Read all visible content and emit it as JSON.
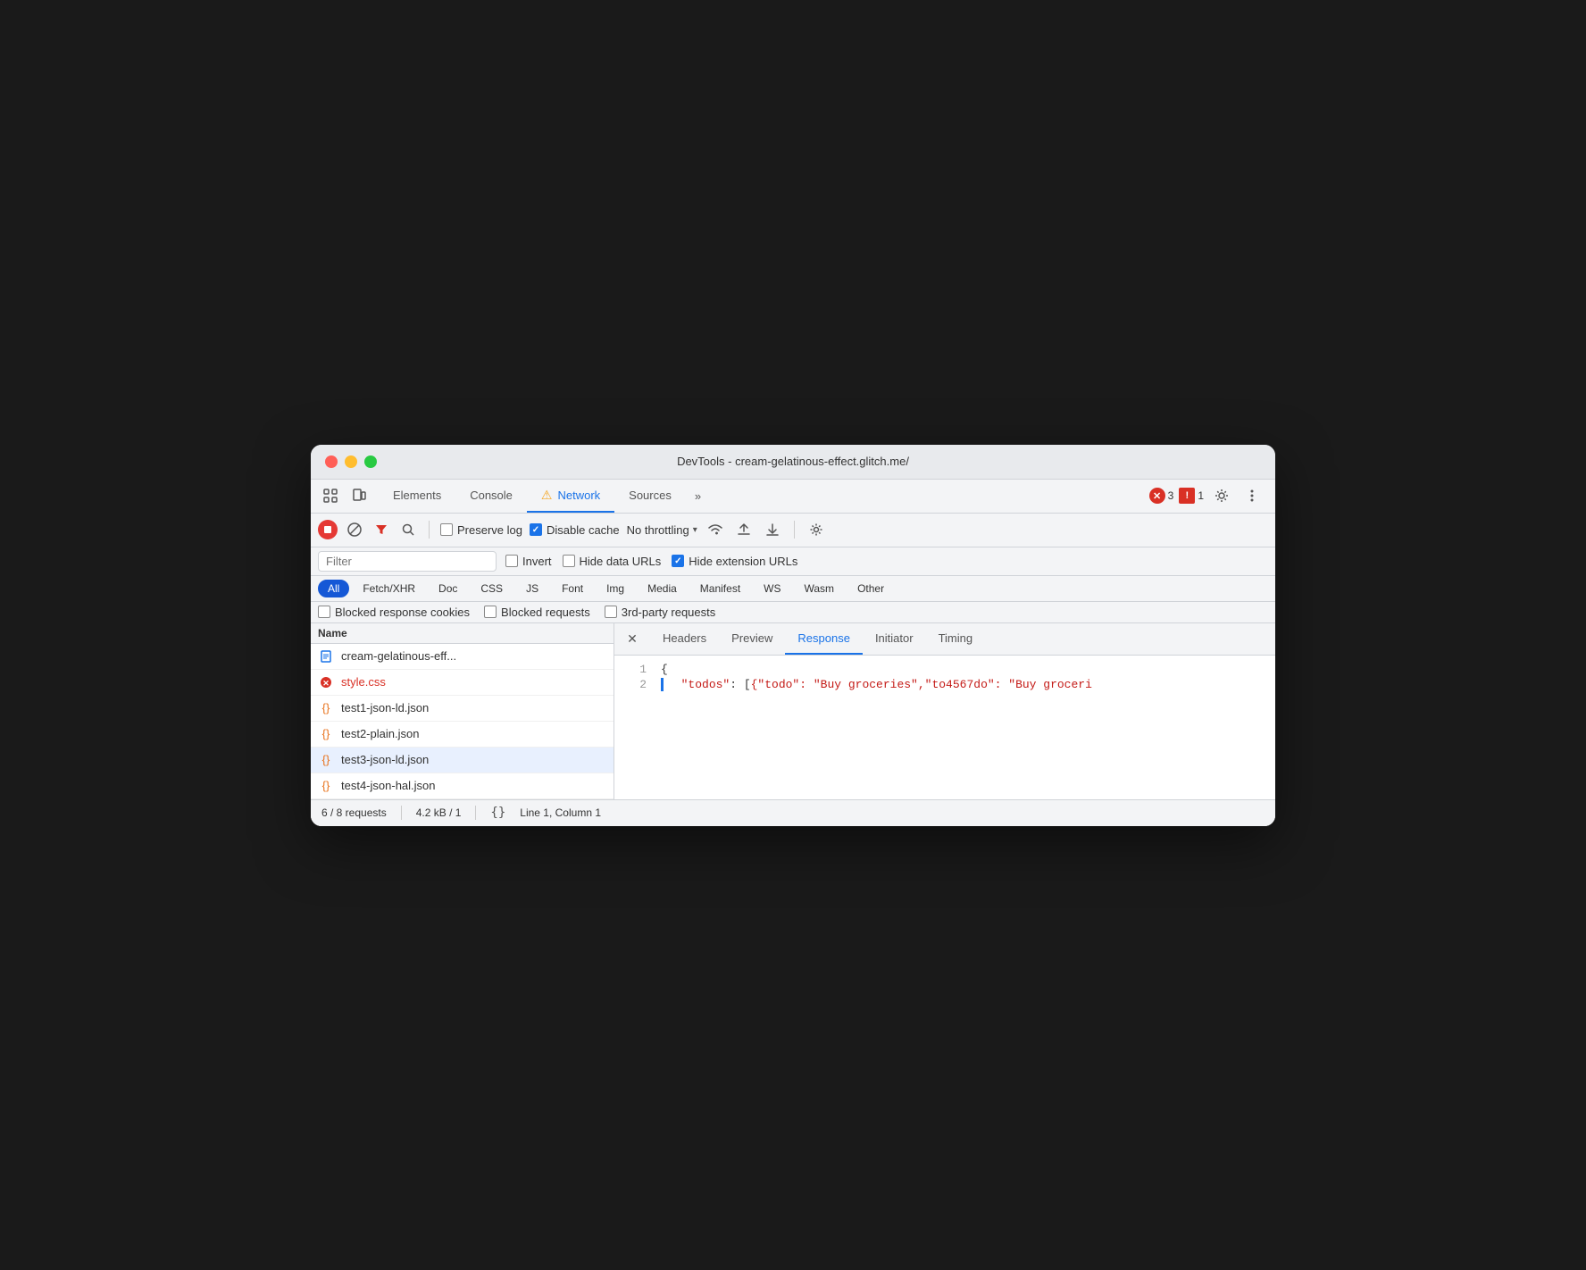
{
  "window": {
    "title": "DevTools - cream-gelatinous-effect.glitch.me/"
  },
  "top_toolbar": {
    "tabs": [
      {
        "id": "elements",
        "label": "Elements",
        "active": false,
        "warning": false
      },
      {
        "id": "console",
        "label": "Console",
        "active": false,
        "warning": false
      },
      {
        "id": "network",
        "label": "Network",
        "active": true,
        "warning": true
      },
      {
        "id": "sources",
        "label": "Sources",
        "active": false,
        "warning": false
      }
    ],
    "more_label": "»",
    "error_count": "3",
    "warning_count": "1"
  },
  "second_toolbar": {
    "throttle_label": "No throttling"
  },
  "filter_bar": {
    "placeholder": "Filter",
    "invert_label": "Invert",
    "hide_data_urls_label": "Hide data URLs",
    "hide_extension_urls_label": "Hide extension URLs"
  },
  "type_filters": {
    "buttons": [
      {
        "id": "all",
        "label": "All",
        "active": true
      },
      {
        "id": "fetch_xhr",
        "label": "Fetch/XHR",
        "active": false
      },
      {
        "id": "doc",
        "label": "Doc",
        "active": false
      },
      {
        "id": "css",
        "label": "CSS",
        "active": false
      },
      {
        "id": "js",
        "label": "JS",
        "active": false
      },
      {
        "id": "font",
        "label": "Font",
        "active": false
      },
      {
        "id": "img",
        "label": "Img",
        "active": false
      },
      {
        "id": "media",
        "label": "Media",
        "active": false
      },
      {
        "id": "manifest",
        "label": "Manifest",
        "active": false
      },
      {
        "id": "ws",
        "label": "WS",
        "active": false
      },
      {
        "id": "wasm",
        "label": "Wasm",
        "active": false
      },
      {
        "id": "other",
        "label": "Other",
        "active": false
      }
    ]
  },
  "checkbox_filters": {
    "blocked_cookies": "Blocked response cookies",
    "blocked_requests": "Blocked requests",
    "third_party": "3rd-party requests"
  },
  "column_header": {
    "name": "Name"
  },
  "file_list": [
    {
      "id": "cream",
      "icon": "doc",
      "name": "cream-gelatinous-eff...",
      "error": false,
      "selected": false
    },
    {
      "id": "style",
      "icon": "error",
      "name": "style.css",
      "error": true,
      "selected": false
    },
    {
      "id": "test1",
      "icon": "json",
      "name": "test1-json-ld.json",
      "error": false,
      "selected": false
    },
    {
      "id": "test2",
      "icon": "json",
      "name": "test2-plain.json",
      "error": false,
      "selected": false
    },
    {
      "id": "test3",
      "icon": "json",
      "name": "test3-json-ld.json",
      "error": false,
      "selected": true
    },
    {
      "id": "test4",
      "icon": "json",
      "name": "test4-json-hal.json",
      "error": false,
      "selected": false
    }
  ],
  "response_panel": {
    "tabs": [
      {
        "id": "headers",
        "label": "Headers",
        "active": false
      },
      {
        "id": "preview",
        "label": "Preview",
        "active": false
      },
      {
        "id": "response",
        "label": "Response",
        "active": true
      },
      {
        "id": "initiator",
        "label": "Initiator",
        "active": false
      },
      {
        "id": "timing",
        "label": "Timing",
        "active": false
      }
    ],
    "lines": [
      {
        "num": "1",
        "content": "{",
        "has_bar": false
      },
      {
        "num": "2",
        "content_parts": [
          {
            "text": "  ",
            "type": "plain"
          },
          {
            "text": "\"todos\"",
            "type": "key"
          },
          {
            "text": ": [",
            "type": "plain"
          },
          {
            "text": "{\"todo\": \"Buy groceries\",\"to4567do\": \"Buy groceri",
            "type": "value"
          }
        ],
        "has_bar": true
      }
    ]
  },
  "status_bar": {
    "requests": "6 / 8 requests",
    "size": "4.2 kB / 1",
    "position": "Line 1, Column 1"
  }
}
